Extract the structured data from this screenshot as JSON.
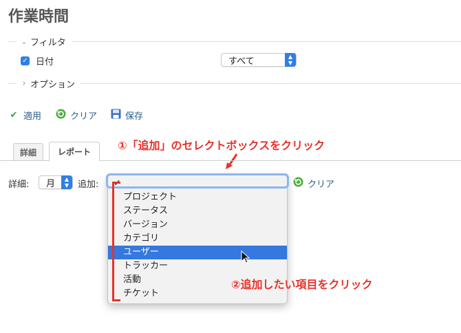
{
  "header": {
    "title": "作業時間"
  },
  "filter": {
    "legend": "フィルタ",
    "date_label": "日付",
    "date_select": "すべて"
  },
  "options": {
    "legend": "オプション"
  },
  "actions": {
    "apply": "適用",
    "clear": "クリア",
    "save": "保存"
  },
  "tabs": [
    {
      "label": "詳細",
      "active": false
    },
    {
      "label": "レポート",
      "active": true
    }
  ],
  "report": {
    "detail_label": "詳細:",
    "detail_select": "月",
    "add_label": "追加:",
    "clear_label": "クリア"
  },
  "dropdown": {
    "checkmark": "✓",
    "items": [
      "プロジェクト",
      "ステータス",
      "バージョン",
      "カテゴリ",
      "ユーザー",
      "トラッカー",
      "活動",
      "チケット"
    ],
    "highlighted": "ユーザー"
  },
  "annotations": {
    "step1": "①「追加」のセレクトボックスをクリック",
    "step2": "②追加したい項目をクリック"
  },
  "colors": {
    "accent": "#2f7fe6",
    "annotation": "#e8322a",
    "link": "#2a5d8b",
    "highlight": "#3478e0"
  },
  "icons": {
    "apply": "check-icon",
    "clear": "refresh-icon",
    "save": "floppy-disk-icon"
  }
}
